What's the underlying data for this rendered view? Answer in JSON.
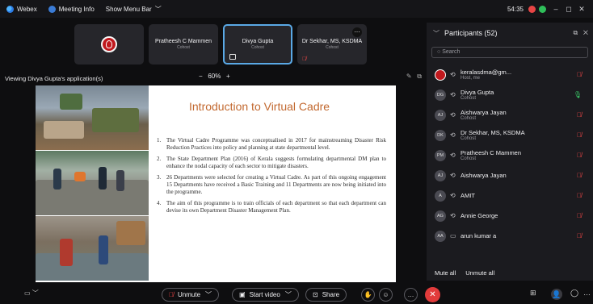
{
  "topbar": {
    "app_name": "Webex",
    "meeting_info": "Meeting Info",
    "show_menu_bar": "Show Menu Bar",
    "timer": "54:35",
    "colors": {
      "accent": "#5aa9e6",
      "record": "#e84545",
      "status": "#2fbf5a"
    }
  },
  "strip": {
    "tiles": [
      {
        "name": "",
        "role": ""
      },
      {
        "name": "Pratheesh C Mammen",
        "role": "Cohost"
      },
      {
        "name": "Divya Gupta",
        "role": "Cohost"
      },
      {
        "name": "Dr Sekhar, MS, KSDMA",
        "role": "Cohost"
      }
    ]
  },
  "share": {
    "viewing_label": "Viewing Divya Gupta's application(s)",
    "zoom_minus": "−",
    "zoom_level": "60%",
    "zoom_plus": "+"
  },
  "slide": {
    "title": "Introduction to Virtual Cadre",
    "points": [
      {
        "num": "1.",
        "text": "The Virtual Cadre Programme was conceptualised in 2017 for mainstreaming Disaster Risk Reduction Practices into policy and planning at state departmental level."
      },
      {
        "num": "2.",
        "text": "The State Department Plan (2016) of Kerala suggests formulating departmental DM plan to enhance the nodal capacity of each sector to mitigate disasters."
      },
      {
        "num": "3.",
        "text": "26 Departments were selected for creating a Virtual Cadre. As part of this ongoing engagement 15 Departments have received a Basic Training and 11 Departments are now being initiated into the programme."
      },
      {
        "num": "4.",
        "text": "The aim of this programme is to train officials of each department so that each department can devise its own Department Disaster Management Plan."
      }
    ]
  },
  "participants": {
    "title": "Participants (52)",
    "search_placeholder": "Search",
    "list": [
      {
        "initials": "",
        "name": "keralasdma@gm...",
        "role": "Host, me",
        "mic": "muted"
      },
      {
        "initials": "DG",
        "name": "Divya Gupta",
        "role": "Cohost",
        "mic": "live"
      },
      {
        "initials": "AJ",
        "name": "Aishwarya Jayan",
        "role": "Cohost",
        "mic": "muted"
      },
      {
        "initials": "DK",
        "name": "Dr Sekhar, MS, KSDMA",
        "role": "Cohost",
        "mic": "muted"
      },
      {
        "initials": "PM",
        "name": "Pratheesh C Mammen",
        "role": "Cohost",
        "mic": "muted"
      },
      {
        "initials": "AJ",
        "name": "Aishwarya Jayan",
        "role": "",
        "mic": "muted"
      },
      {
        "initials": "A",
        "name": "AMIT",
        "role": "",
        "mic": "muted"
      },
      {
        "initials": "AG",
        "name": "Annie George",
        "role": "",
        "mic": "muted"
      },
      {
        "initials": "AA",
        "name": "arun kumar a",
        "role": "",
        "mic": "muted"
      }
    ],
    "mute_all": "Mute all",
    "unmute_all": "Unmute all"
  },
  "controls": {
    "unmute": "Unmute",
    "start_video": "Start video",
    "share": "Share"
  }
}
